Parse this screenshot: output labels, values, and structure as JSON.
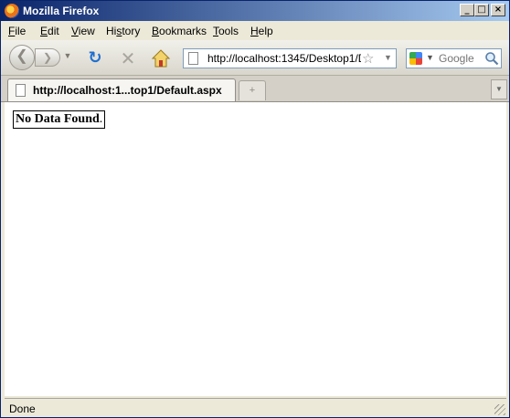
{
  "window": {
    "title": "Mozilla Firefox"
  },
  "menu": [
    {
      "mnemonic": "F",
      "rest": "ile"
    },
    {
      "mnemonic": "E",
      "rest": "dit"
    },
    {
      "mnemonic": "V",
      "rest": "iew"
    },
    {
      "mnemonic": "",
      "rest": "Hi",
      "mnemonic2": "s",
      "rest2": "tory"
    },
    {
      "mnemonic": "B",
      "rest": "ookmarks"
    },
    {
      "mnemonic": "T",
      "rest": "ools"
    },
    {
      "mnemonic": "H",
      "rest": "elp"
    }
  ],
  "address": {
    "url": "http://localhost:1345/Desktop1/D"
  },
  "search": {
    "placeholder": "Google"
  },
  "tabs": [
    {
      "label": "http://localhost:1...top1/Default.aspx"
    }
  ],
  "content": {
    "message": "No Data Found",
    "suffix": "."
  },
  "status": {
    "text": "Done"
  },
  "icons": {
    "app": "firefox-icon",
    "back": "back-arrow-icon",
    "forward": "forward-arrow-icon",
    "reload": "reload-icon",
    "stop": "stop-icon",
    "home": "home-icon",
    "bookmark": "star-icon",
    "search": "magnifier-icon"
  }
}
